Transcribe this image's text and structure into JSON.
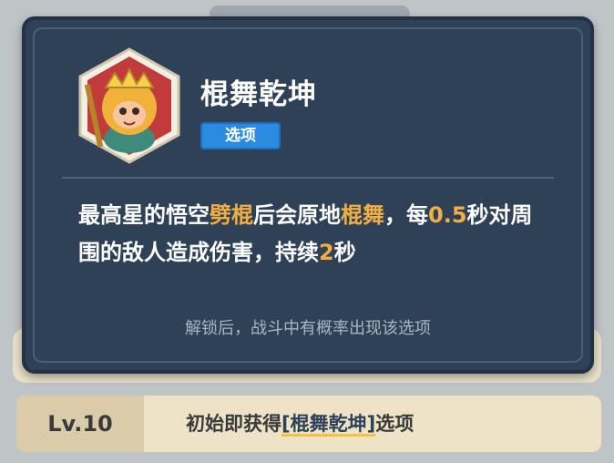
{
  "skill": {
    "title": "棍舞乾坤",
    "tag": "选项",
    "desc_parts": [
      {
        "text": "最高星的悟空",
        "highlight": false
      },
      {
        "text": "劈棍",
        "highlight": true
      },
      {
        "text": "后会原地",
        "highlight": false
      },
      {
        "text": "棍舞",
        "highlight": true
      },
      {
        "text": "，每",
        "highlight": false
      },
      {
        "text": "0.5",
        "highlight": true
      },
      {
        "text": "秒对周围的敌人造成伤害，持续",
        "highlight": false
      },
      {
        "text": "2",
        "highlight": true
      },
      {
        "text": "秒",
        "highlight": false
      }
    ],
    "unlock_note": "解锁后，战斗中有概率出现该选项",
    "portrait_icon": "monkey-king-portrait"
  },
  "level_row": {
    "level": "Lv.10",
    "prefix": "初始即获得",
    "bracket_open": "[",
    "name": "棍舞乾坤",
    "bracket_close": "]",
    "suffix": "选项"
  },
  "colors": {
    "card_bg": "#2e4157",
    "highlight": "#f2ae44",
    "tag_bg": "#2b8be0",
    "row_bg": "#eee3c6"
  }
}
